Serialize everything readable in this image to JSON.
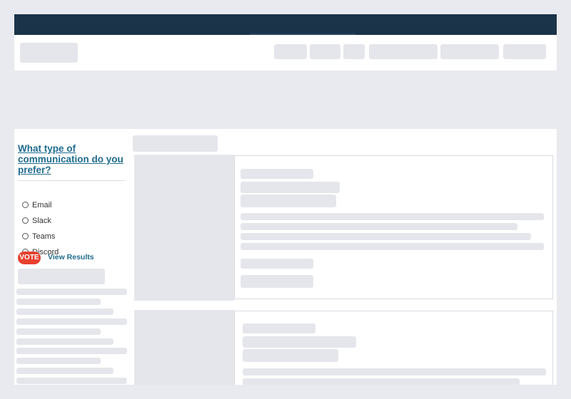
{
  "poll": {
    "question": "What type of communication do you prefer?",
    "options": [
      {
        "label": "Email"
      },
      {
        "label": "Slack"
      },
      {
        "label": "Teams"
      },
      {
        "label": "Discord"
      }
    ],
    "vote_label": "VOTE",
    "results_label": "View Results"
  },
  "colors": {
    "topbar": "#1b3349",
    "accent": "#e8412f",
    "link": "#1f6b8e",
    "skeleton": "#e5e6ec",
    "background": "#e9eaef"
  }
}
